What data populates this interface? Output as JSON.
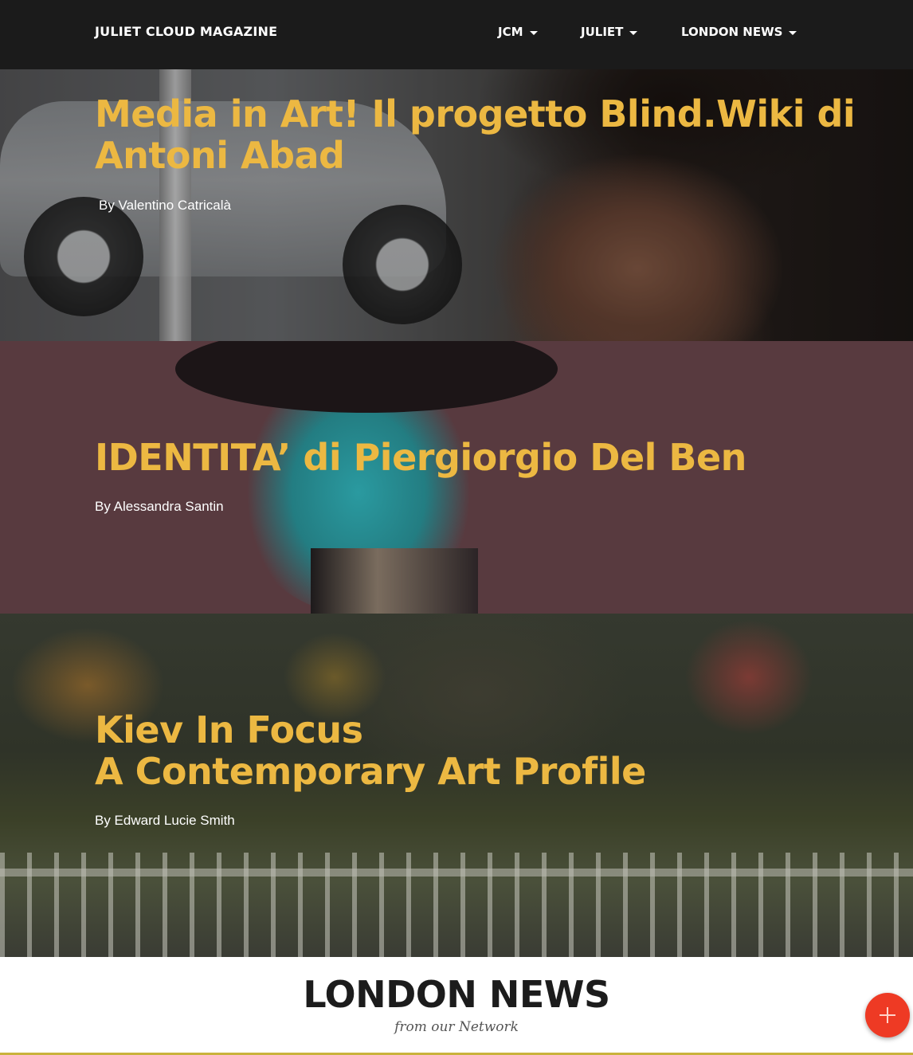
{
  "navbar": {
    "brand": "JULIET CLOUD MAGAZINE",
    "items": [
      {
        "label": "JCM"
      },
      {
        "label": "JULIET"
      },
      {
        "label": "LONDON NEWS"
      }
    ]
  },
  "articles": [
    {
      "title_line1": "Media in Art! Il progetto Blind.Wiki di",
      "title_line2": "Antoni Abad",
      "author": "By Valentino Catricalà"
    },
    {
      "title_line1": "IDENTITA’ di Piergiorgio Del Ben",
      "author": "By Alessandra Santin"
    },
    {
      "title_line1": "Kiev In Focus",
      "title_line2": "A Contemporary Art Profile",
      "author": "By Edward Lucie Smith"
    }
  ],
  "section": {
    "title": "LONDON NEWS",
    "subtitle": "from our Network"
  },
  "colors": {
    "accent": "#ecb842",
    "navbar": "#1b1b1b",
    "fab": "#ee3a24",
    "hero2_bg": "#583a3f"
  },
  "fab": {
    "icon": "plus-icon"
  }
}
